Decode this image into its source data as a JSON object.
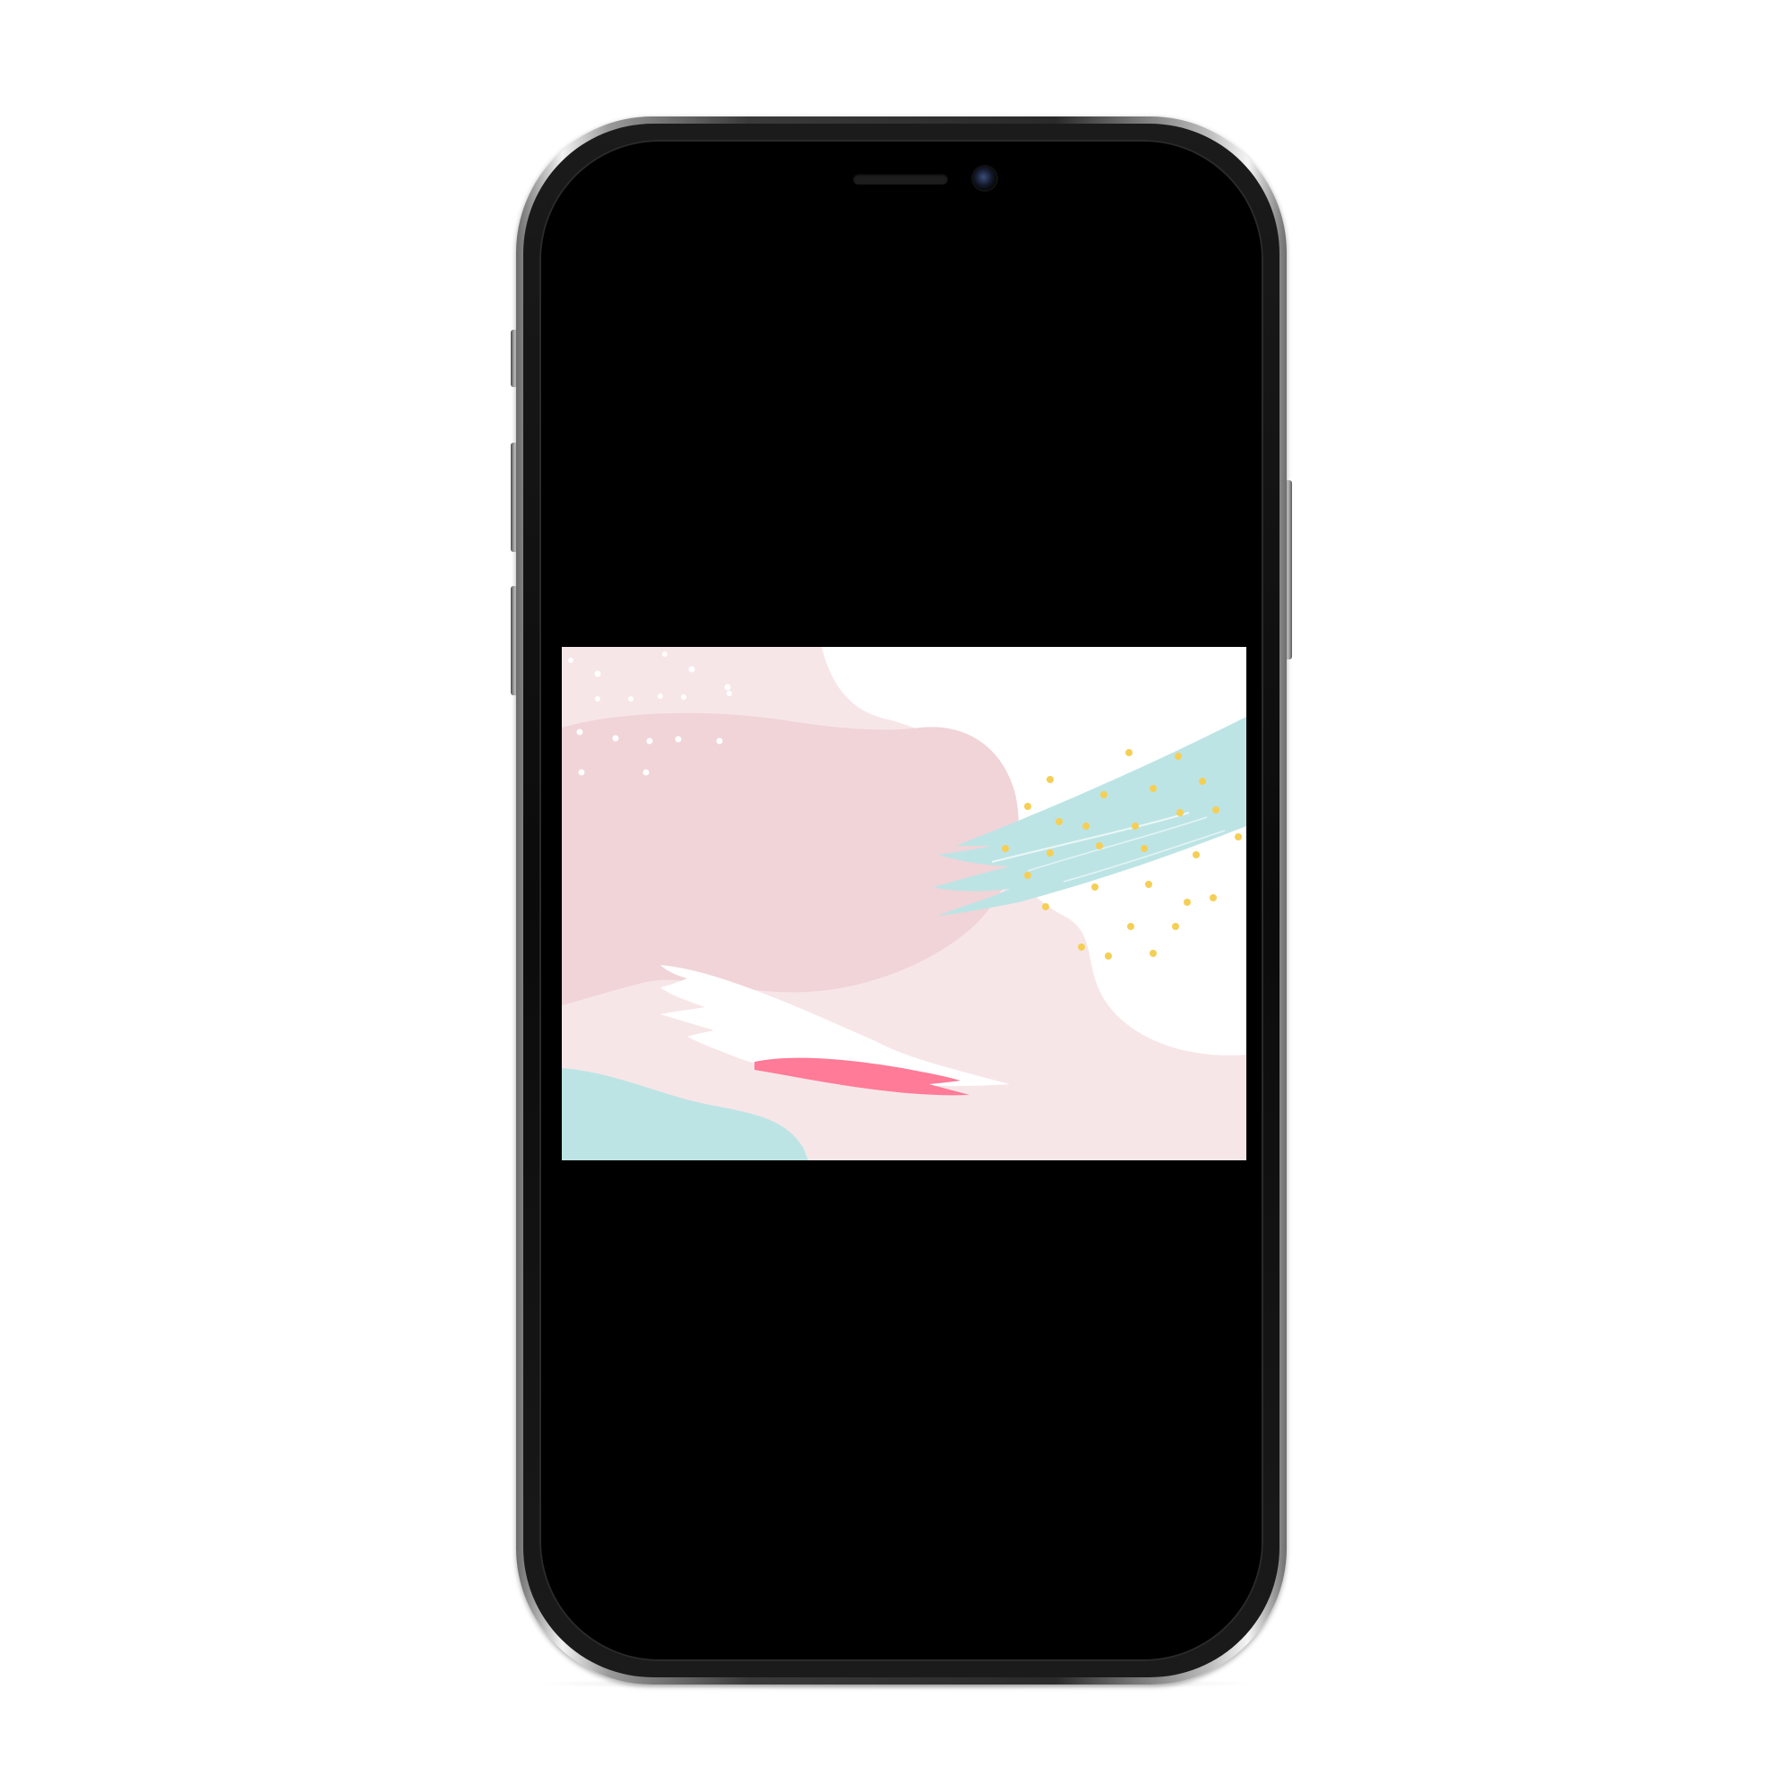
{
  "device": {
    "type": "smartphone",
    "frame_color": "#2b2b2b",
    "screen_color": "#000000"
  },
  "icons": {
    "speaker": "earpiece-speaker-icon",
    "camera": "front-camera-icon"
  },
  "wallpaper": {
    "kind": "abstract pastel brush-stroke artwork",
    "colors": {
      "background_pink": "#f7e6e8",
      "blob_pink": "#f0d4d8",
      "white": "#ffffff",
      "mint": "#bde4e5",
      "hot_pink": "#ff7b98",
      "gold_dots": "#f5cf55"
    }
  }
}
